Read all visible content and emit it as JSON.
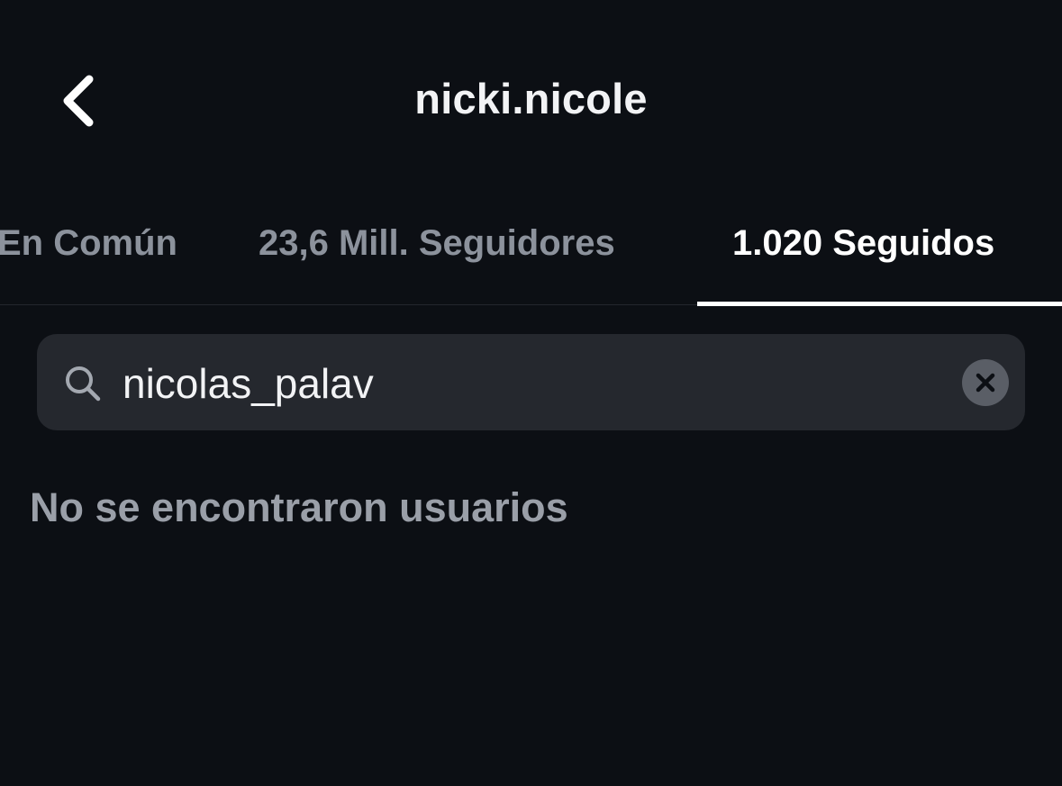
{
  "header": {
    "title": "nicki.nicole",
    "back_icon": "chevron-left-icon"
  },
  "tabs": [
    {
      "label": "En Común",
      "active": false
    },
    {
      "label": "23,6 Mill. Seguidores",
      "active": false
    },
    {
      "label": "1.020 Seguidos",
      "active": true
    }
  ],
  "search": {
    "value": "nicolas_palav",
    "icon": "search-icon",
    "clear_icon": "clear-icon"
  },
  "results": {
    "empty_message": "No se encontraron usuarios"
  },
  "colors": {
    "background": "#0c0f14",
    "search_bg": "#25282e",
    "active_text": "#ffffff",
    "inactive_text": "#8c929c"
  }
}
